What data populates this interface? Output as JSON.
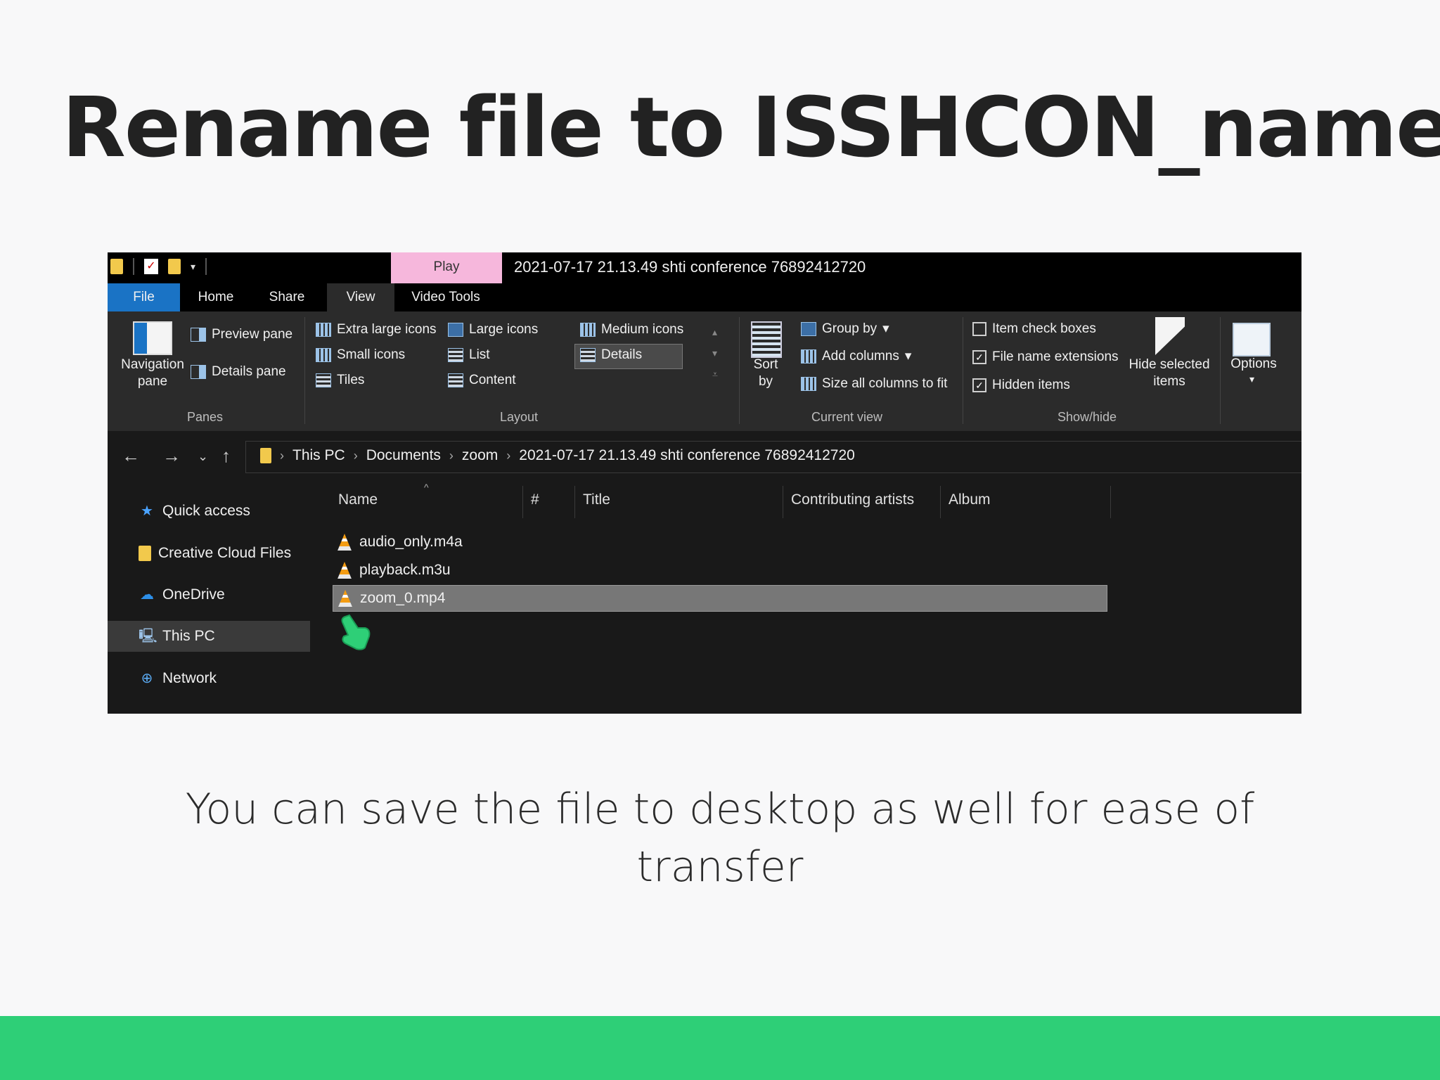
{
  "slide": {
    "title": "Rename file to ISSHCON_name",
    "caption": "You can save the file to desktop as well for ease of transfer",
    "accent_color": "#2ecf77"
  },
  "window": {
    "title": "2021-07-17 21.13.49 shti conference 76892412720",
    "context_tab": "Play",
    "context_tab_color": "#f6b7dc"
  },
  "ribbon": {
    "tabs": {
      "file": "File",
      "home": "Home",
      "share": "Share",
      "view": "View",
      "video_tools": "Video Tools"
    },
    "panes": {
      "label": "Panes",
      "navigation_pane": "Navigation pane",
      "preview_pane": "Preview pane",
      "details_pane": "Details pane"
    },
    "layout": {
      "label": "Layout",
      "extra_large_icons": "Extra large icons",
      "large_icons": "Large icons",
      "medium_icons": "Medium icons",
      "small_icons": "Small icons",
      "list": "List",
      "details": "Details",
      "tiles": "Tiles",
      "content": "Content"
    },
    "current_view": {
      "label": "Current view",
      "sort_by": "Sort by",
      "group_by": "Group by",
      "add_columns": "Add columns",
      "size_all_columns": "Size all columns to fit"
    },
    "show_hide": {
      "label": "Show/hide",
      "item_check_boxes": "Item check boxes",
      "file_name_extensions": "File name extensions",
      "hidden_items": "Hidden items",
      "hide_selected_items": "Hide selected items"
    },
    "options": "Options"
  },
  "address": {
    "crumbs": [
      "This PC",
      "Documents",
      "zoom",
      "2021-07-17 21.13.49 shti conference 76892412720"
    ]
  },
  "nav": {
    "quick_access": "Quick access",
    "creative_cloud": "Creative Cloud Files",
    "onedrive": "OneDrive",
    "this_pc": "This PC",
    "network": "Network"
  },
  "columns": {
    "name": "Name",
    "number": "#",
    "title": "Title",
    "artists": "Contributing artists",
    "album": "Album"
  },
  "files": [
    "audio_only.m4a",
    "playback.m3u",
    "zoom_0.mp4"
  ]
}
